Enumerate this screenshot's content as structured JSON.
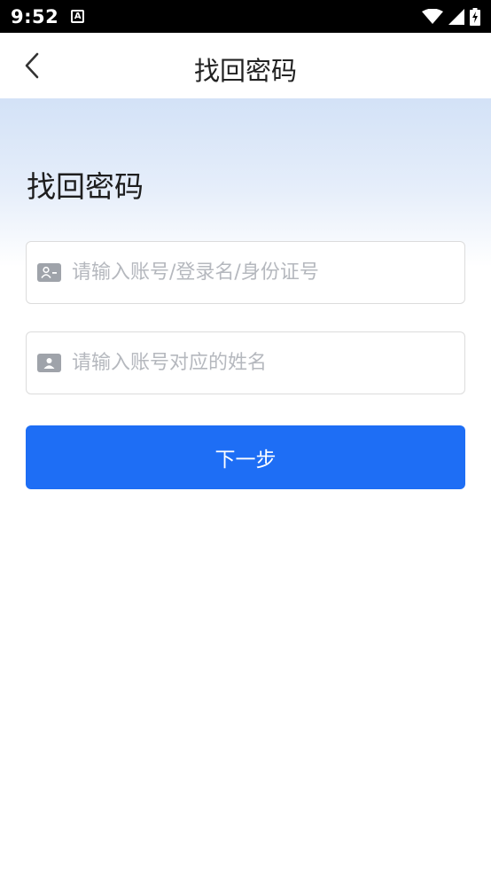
{
  "status_bar": {
    "time": "9:52",
    "notification_icon": "a-letter-icon",
    "icons": [
      "wifi-icon",
      "signal-icon",
      "battery-charging-icon"
    ]
  },
  "nav": {
    "back_icon": "chevron-left-icon",
    "title": "找回密码"
  },
  "hero": {
    "title": "找回密码"
  },
  "form": {
    "account_field": {
      "icon": "id-card-icon",
      "placeholder": "请输入账号/登录名/身份证号",
      "value": ""
    },
    "name_field": {
      "icon": "person-card-icon",
      "placeholder": "请输入账号对应的姓名",
      "value": ""
    },
    "next_button_label": "下一步"
  },
  "colors": {
    "primary": "#1e6ef5",
    "hero_gradient_top": "#d3e2f7",
    "placeholder": "#b5b8be",
    "icon_gray": "#9fa3aa"
  }
}
